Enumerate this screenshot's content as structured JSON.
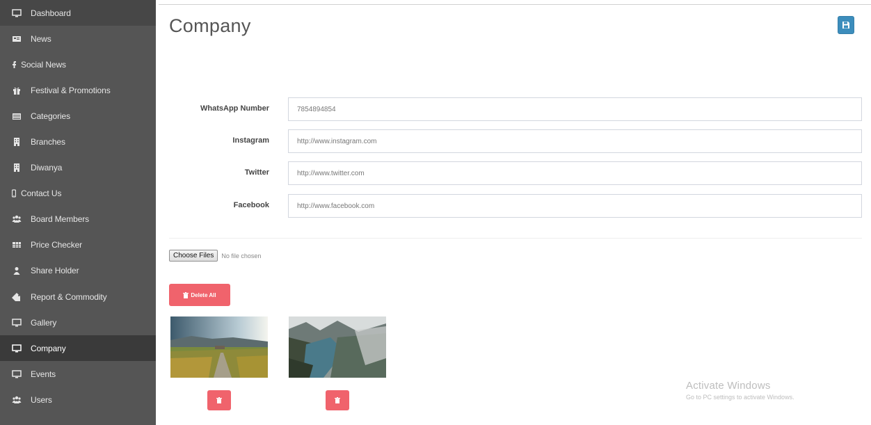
{
  "sidebar": {
    "items": [
      {
        "label": "Dashboard",
        "icon": "monitor-icon"
      },
      {
        "label": "News",
        "icon": "newspaper-icon"
      },
      {
        "label": "Social News",
        "icon": "facebook-icon"
      },
      {
        "label": "Festival & Promotions",
        "icon": "gift-icon"
      },
      {
        "label": "Categories",
        "icon": "list-icon"
      },
      {
        "label": "Branches",
        "icon": "building-icon"
      },
      {
        "label": "Diwanya",
        "icon": "building-icon"
      },
      {
        "label": "Contact Us",
        "icon": "mobile-icon"
      },
      {
        "label": "Board Members",
        "icon": "users-icon"
      },
      {
        "label": "Price Checker",
        "icon": "table-icon"
      },
      {
        "label": "Share Holder",
        "icon": "user-icon"
      },
      {
        "label": "Report & Commodity",
        "icon": "tag-icon"
      },
      {
        "label": "Gallery",
        "icon": "monitor-icon"
      },
      {
        "label": "Company",
        "icon": "monitor-icon"
      },
      {
        "label": "Events",
        "icon": "monitor-icon"
      },
      {
        "label": "Users",
        "icon": "users-icon"
      }
    ],
    "active": "Company"
  },
  "header": {
    "title": "Company",
    "save_icon": "save-icon",
    "accent_color": "#3c8dbc"
  },
  "form": {
    "whatsapp": {
      "label": "WhatsApp Number",
      "value": "7854894854"
    },
    "instagram": {
      "label": "Instagram",
      "value": "http://www.instagram.com"
    },
    "twitter": {
      "label": "Twitter",
      "value": "http://www.twitter.com"
    },
    "facebook": {
      "label": "Facebook",
      "value": "http://www.facebook.com"
    }
  },
  "upload": {
    "button_label": "Choose Files",
    "status": "No file chosen"
  },
  "gallery": {
    "delete_all_label": "Delete All",
    "delete_color": "#f0636c"
  },
  "watermark": {
    "title": "Activate Windows",
    "subtitle": "Go to PC settings to activate Windows."
  }
}
